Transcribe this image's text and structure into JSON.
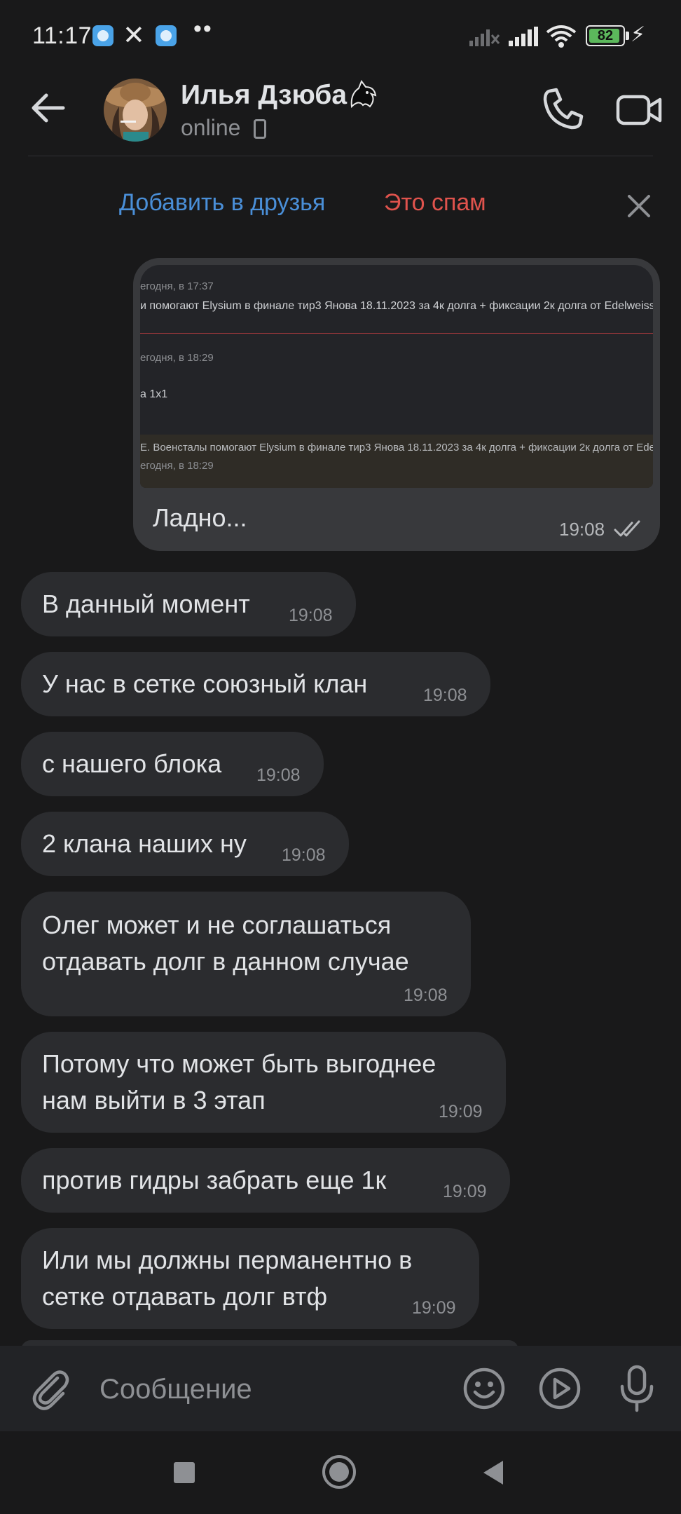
{
  "status_bar": {
    "time": "11:17",
    "battery": "82",
    "notification_icons": [
      "app-icon",
      "x-icon",
      "app-icon",
      "more-dots-icon"
    ],
    "x_glyph": "✕",
    "dots": "••",
    "bolt": "⚡"
  },
  "header": {
    "contact_name": "Илья Дзюба",
    "status": "online"
  },
  "friend_bar": {
    "add_friend": "Добавить в друзья",
    "spam": "Это спам"
  },
  "outgoing": {
    "screenshot": {
      "line1_meta": "егодня, в 17:37",
      "line1_text": "и помогают Elysium в финале тир3 Янова 18.11.2023 за 4к долга + фиксации 2к долга от Edelweiss, в",
      "line2_meta": "егодня, в 18:29",
      "line2_text": "а 1x1",
      "line3_text": "E. Военсталы помогают Elysium в финале тир3 Янова 18.11.2023 за 4к долга + фиксации 2к долга от Edelweiss, в",
      "line3_meta": "егодня, в 18:29"
    },
    "text": "Ладно...",
    "time": "19:08"
  },
  "messages": [
    {
      "text": "В данный момент",
      "time": "19:08"
    },
    {
      "text": "У нас в сетке союзный клан",
      "time": "19:08"
    },
    {
      "text": "с нашего блока",
      "time": "19:08"
    },
    {
      "text": "2 клана наших ну",
      "time": "19:08"
    },
    {
      "text": "Олег может и не соглашаться\nотдавать долг в данном случае",
      "time": "19:08"
    },
    {
      "text": "Потому что может быть выгоднее\nнам выйти в 3 этап",
      "time": "19:09"
    },
    {
      "text": "против гидры забрать еще 1к",
      "time": "19:09"
    },
    {
      "text": "Или мы должны перманентно в\nсетке отдавать долг втф",
      "time": "19:09"
    }
  ],
  "composer": {
    "placeholder": "Сообщение"
  },
  "colors": {
    "background": "#19191a",
    "bubble_in": "#2b2c2f",
    "bubble_out": "#38393c",
    "link_blue": "#4a8fd8",
    "spam_red": "#e0534d",
    "battery_green": "#5cb85c"
  }
}
